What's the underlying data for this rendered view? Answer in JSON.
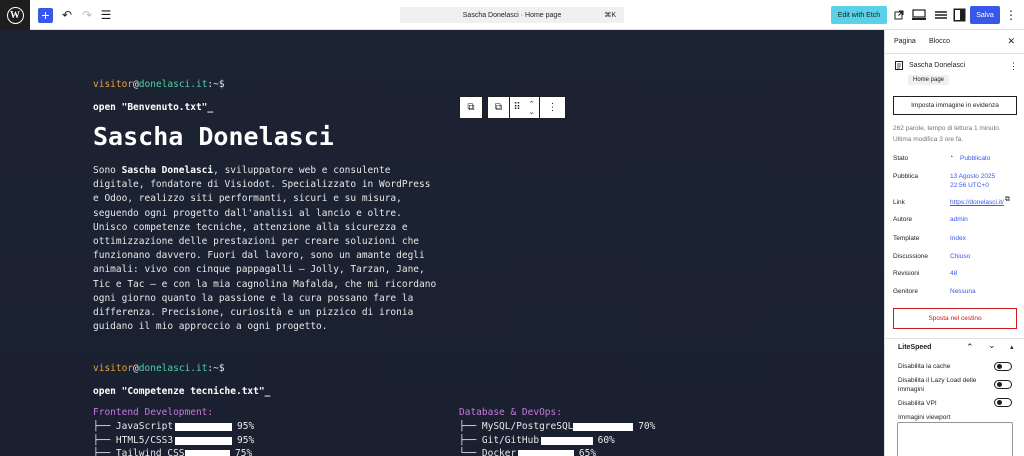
{
  "topbar": {
    "add_icon": "+",
    "undo_icon": "↶",
    "redo_icon": "↷",
    "list_icon": "☰",
    "doc_title": "Sascha Donelasci · Home page",
    "shortcut": "⌘K",
    "etch_label": "Edit with Etch",
    "save_label": "Salva",
    "more_icon": "⋮"
  },
  "canvas": {
    "prompt": {
      "user": "visitor",
      "at": "@",
      "host": "donelasci.it",
      "suffix": ":~$"
    },
    "open1": "open \"Benvenuto.txt\"_",
    "title": "Sascha Donelasci",
    "bio_pre": "Sono ",
    "bio_bold": "Sascha Donelasci",
    "bio_post": ", sviluppatore web e consulente digitale, fondatore di Visiodot. Specializzato in WordPress e Odoo, realizzo siti performanti, sicuri e su misura, seguendo ogni progetto dall'analisi al lancio e oltre. Unisco competenze tecniche, attenzione alla sicurezza e ottimizzazione delle prestazioni per creare soluzioni che funzionano davvero. Fuori dal lavoro, sono un amante degli animali: vivo con cinque pappagalli – Jolly, Tarzan, Jane, Tic e Tac – e con la mia cagnolina Mafalda, che mi ricordano ogni giorno quanto la passione e la cura possano fare la differenza. Precisione, curiosità e un pizzico di ironia guidano il mio approccio a ogni progetto.",
    "open2": "open \"Competenze tecniche.txt\"_",
    "frontend_title": "Frontend Development:",
    "frontend": [
      {
        "label": "├── JavaScript",
        "value": 95,
        "pct": "95%"
      },
      {
        "label": "├── HTML5/CSS3",
        "value": 95,
        "pct": "95%"
      },
      {
        "label": "├── Tailwind CSS",
        "value": 75,
        "pct": "75%"
      }
    ],
    "db_title": "Database & DevOps:",
    "db": [
      {
        "label": "├── MySQL/PostgreSQL",
        "value": 70,
        "pct": "70%"
      },
      {
        "label": "├── Git/GitHub",
        "value": 60,
        "pct": "60%"
      },
      {
        "label": "└── Docker",
        "value": 65,
        "pct": "65%"
      }
    ]
  },
  "sidebar": {
    "tab_page": "Pagina",
    "tab_block": "Blocco",
    "close_icon": "✕",
    "page_title": "Sascha Donelasci",
    "chip": "Home page",
    "set_image": "Imposta immagine in evidenza",
    "meta_line1": "262 parole, tempo di lettura 1 minuto.",
    "meta_line2": "Ultima modifica 3 ore fa.",
    "rows": [
      {
        "key": "Stato",
        "value": "Pubblicato"
      },
      {
        "key": "Pubblica",
        "value": "13 Agosto 2025"
      },
      {
        "key": "Link",
        "value": "https://donelasci.it/"
      },
      {
        "key": "Autore",
        "value": "admin"
      },
      {
        "key": "Template",
        "value": "Index"
      },
      {
        "key": "Discussione",
        "value": "Chiuso"
      },
      {
        "key": "Revisioni",
        "value": "48"
      },
      {
        "key": "Genitore",
        "value": "Nessuna"
      }
    ],
    "publish_time": "22:56 UTC+0",
    "trash_label": "Sposta nel cestino",
    "litespeed_title": "LiteSpeed",
    "ls_cache": "Disabilita la cache",
    "ls_lazy1": "Disabilita il Lazy Load delle",
    "ls_lazy2": "immagini",
    "ls_vpi": "Disabilita VPI",
    "ls_viewport": "Immagini viewport"
  },
  "colors": {
    "accent": "#3858e9",
    "etch": "#5ad1e6",
    "canvas_bg": "#1c2332",
    "prompt_user": "#e8a33d",
    "prompt_host": "#4fd1a5",
    "section_title": "#c678dd",
    "danger": "#cc1818"
  }
}
